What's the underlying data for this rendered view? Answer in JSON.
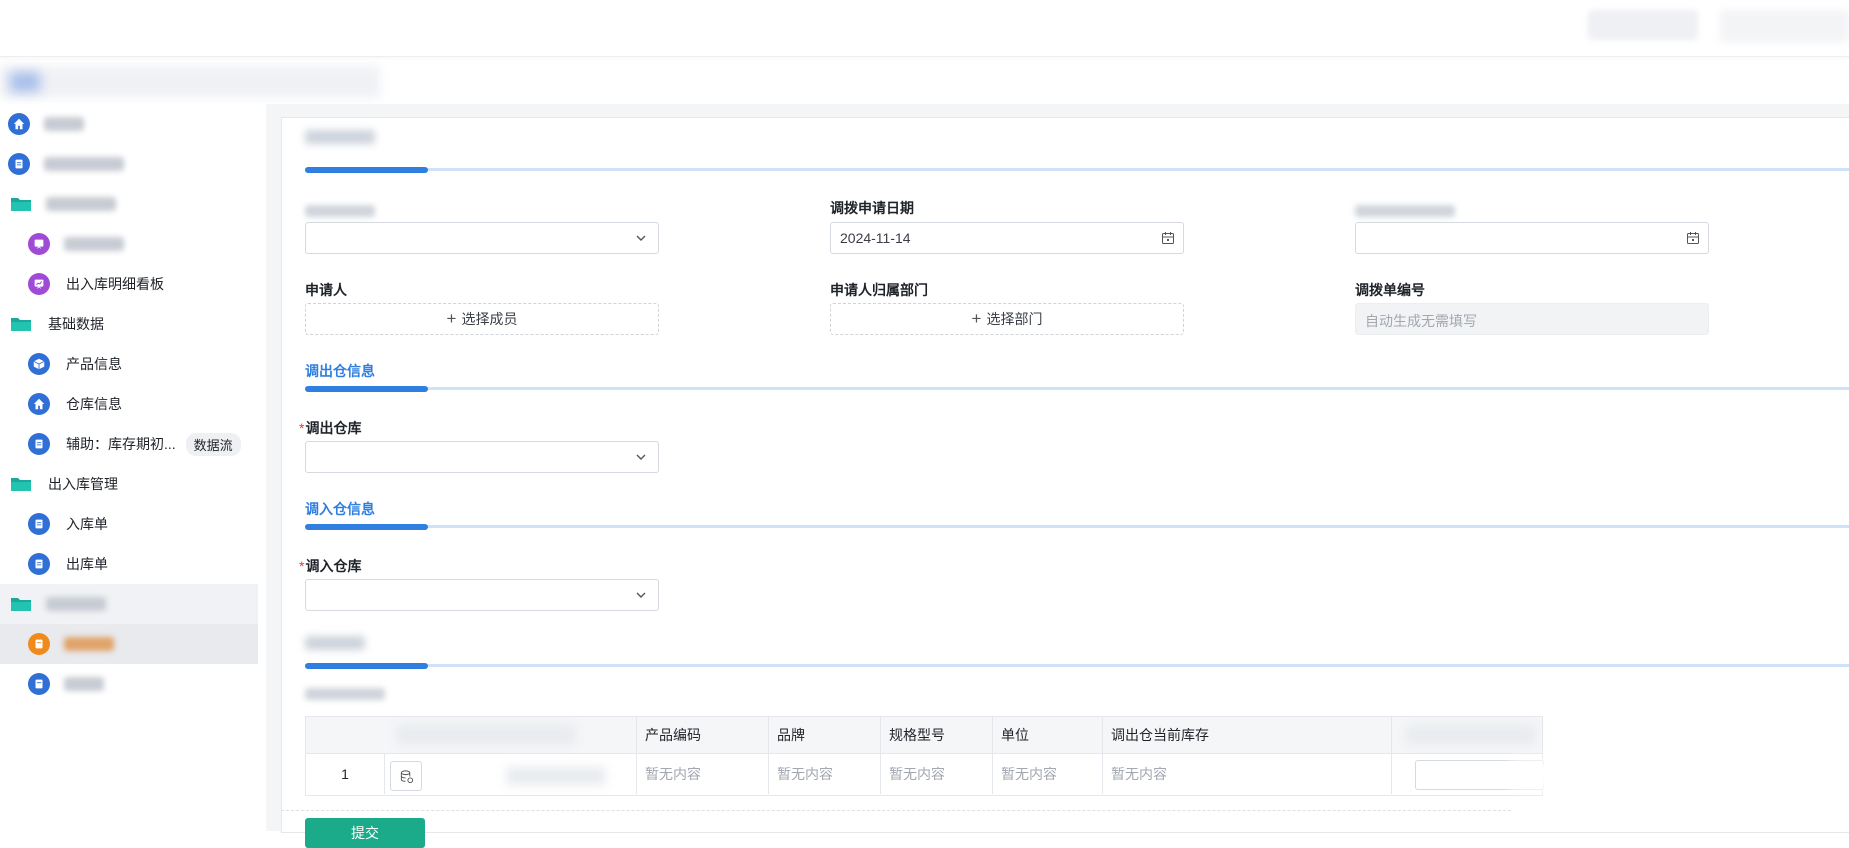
{
  "sidebar": {
    "items": [
      {
        "label": "出入库明细看板"
      },
      {
        "label": "基础数据"
      },
      {
        "label": "产品信息"
      },
      {
        "label": "仓库信息"
      },
      {
        "label": "辅助：库存期初...",
        "tag": "数据流"
      },
      {
        "label": "出入库管理"
      },
      {
        "label": "入库单"
      },
      {
        "label": "出库单"
      }
    ]
  },
  "form": {
    "apply_date_label": "调拨申请日期",
    "apply_date_value": "2024-11-14",
    "applicant_label": "申请人",
    "applicant_btn": "选择成员",
    "dept_label": "申请人归属部门",
    "dept_btn": "选择部门",
    "order_no_label": "调拨单编号",
    "order_no_value": "自动生成无需填写",
    "out_section": "调出仓信息",
    "out_wh_label": "调出仓库",
    "in_section": "调入仓信息",
    "in_wh_label": "调入仓库",
    "required_mark": "*"
  },
  "table": {
    "columns": [
      "产品编码",
      "品牌",
      "规格型号",
      "单位",
      "调出仓当前库存"
    ],
    "row_index": "1",
    "empty_text": "暂无内容"
  },
  "submit_label": "提交",
  "colors": {
    "accent": "#2f7fe0",
    "submit": "#1bab8a",
    "required": "#e53935"
  }
}
